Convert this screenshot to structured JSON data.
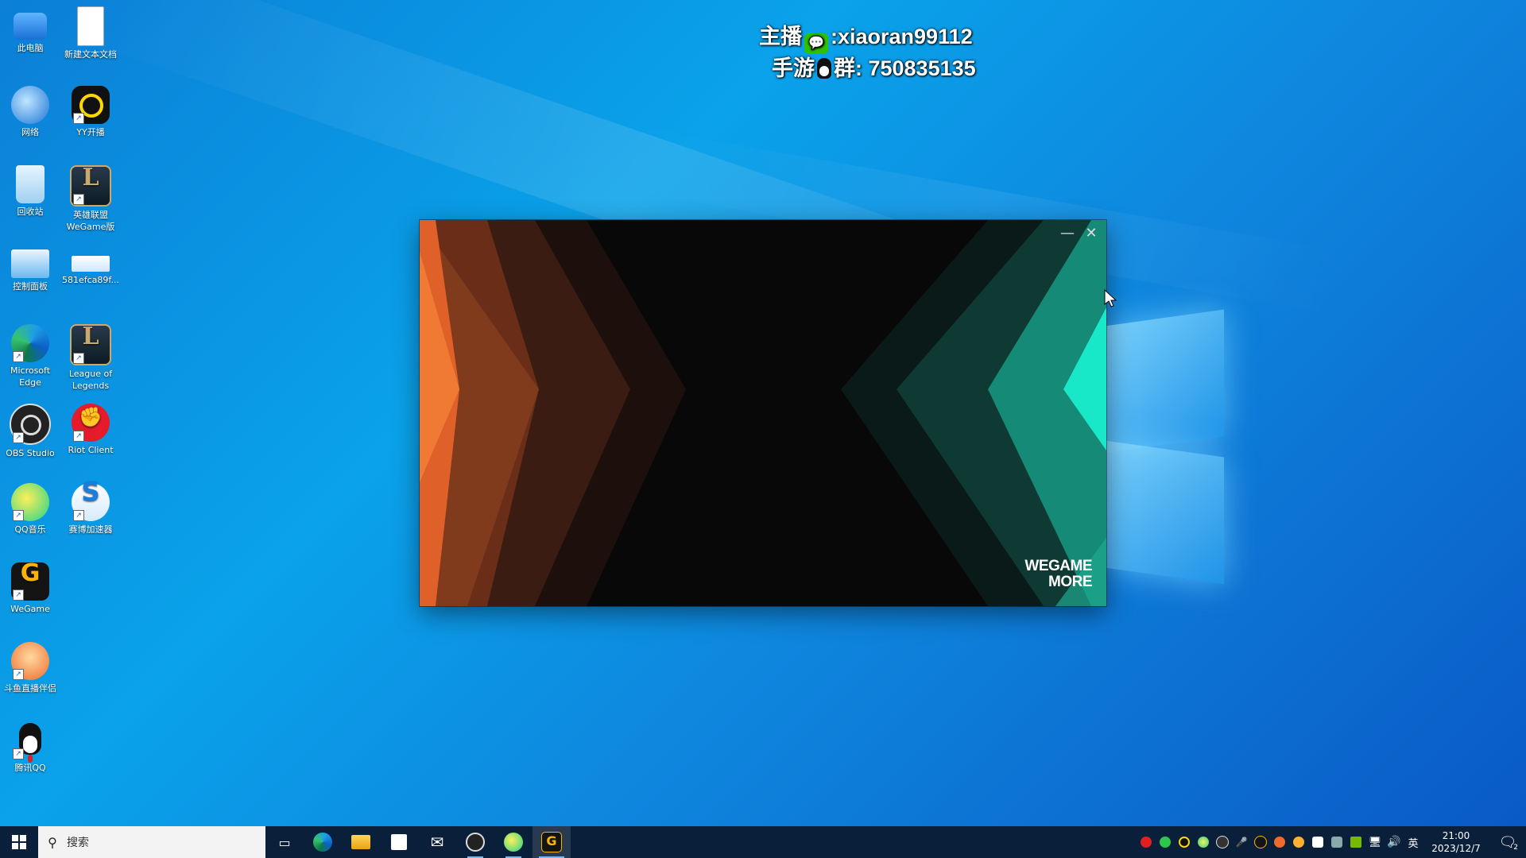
{
  "overlay": {
    "line1_prefix": "主播",
    "line1_value": ":xiaoran99112",
    "line2_prefix": "手游",
    "line2_value": "群: 750835135"
  },
  "desktop_icons": [
    {
      "label": "此电脑",
      "icon": "computer-icon"
    },
    {
      "label": "新建文本文档",
      "icon": "text-document-icon"
    },
    {
      "label": "网络",
      "icon": "network-icon"
    },
    {
      "label": "YY开播",
      "icon": "yy-live-icon"
    },
    {
      "label": "回收站",
      "icon": "recycle-bin-icon"
    },
    {
      "label": "英雄联盟",
      "label2": "WeGame版",
      "icon": "league-wegame-icon"
    },
    {
      "label": "控制面板",
      "icon": "control-panel-icon"
    },
    {
      "label": "581efca89f...",
      "icon": "file-icon"
    },
    {
      "label": "Microsoft",
      "label2": "Edge",
      "icon": "edge-icon"
    },
    {
      "label": "League of",
      "label2": "Legends",
      "icon": "league-of-legends-icon"
    },
    {
      "label": "OBS Studio",
      "icon": "obs-icon"
    },
    {
      "label": "Riot Client",
      "icon": "riot-client-icon"
    },
    {
      "label": "QQ音乐",
      "icon": "qq-music-icon"
    },
    {
      "label": "赛博加速器",
      "icon": "accelerator-icon"
    },
    {
      "label": "WeGame",
      "icon": "wegame-icon"
    },
    {
      "label": "斗鱼直播伴侣",
      "icon": "douyu-icon"
    },
    {
      "label": "腾讯QQ",
      "icon": "qq-icon"
    }
  ],
  "app_window": {
    "brand_line1": "WEGAME",
    "brand_line2": "MORE",
    "minimize_glyph": "—",
    "close_glyph": "✕",
    "colors": {
      "left_accent": "#e0602a",
      "right_accent": "#18e8c8",
      "center": "#080808"
    }
  },
  "taskbar": {
    "search_placeholder": "搜索",
    "pinned": [
      "task-view-icon",
      "edge-icon",
      "file-explorer-icon",
      "store-icon",
      "mail-icon",
      "obs-icon",
      "qq-music-icon",
      "wegame-icon"
    ],
    "active_app": "wegame-icon",
    "language": "英",
    "time": "21:00",
    "date": "2023/12/7",
    "notification_count": "2"
  }
}
